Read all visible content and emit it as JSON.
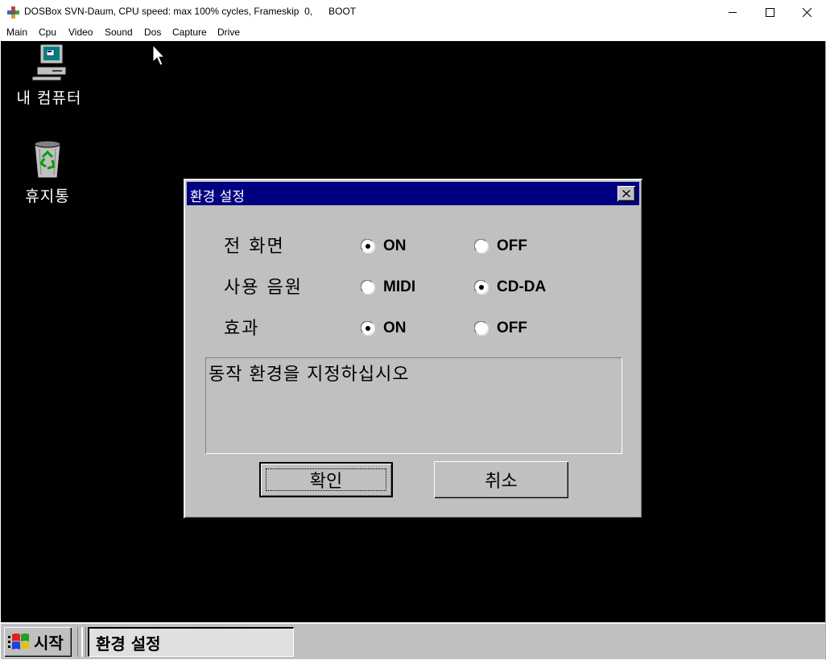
{
  "host_window": {
    "title": "DOSBox SVN-Daum, CPU speed: max 100% cycles, Frameskip  0,      BOOT",
    "menu": [
      "Main",
      "Cpu",
      "Video",
      "Sound",
      "Dos",
      "Capture",
      "Drive"
    ],
    "controls": {
      "minimize_icon": "minimize-icon",
      "maximize_icon": "maximize-icon",
      "close_icon": "close-icon"
    }
  },
  "desktop": {
    "icons": [
      {
        "label": "내 컴퓨터",
        "icon": "my-computer-icon"
      },
      {
        "label": "휴지통",
        "icon": "recycle-bin-icon"
      }
    ]
  },
  "dialog": {
    "title": "환경 설정",
    "rows": [
      {
        "label": "전 화면",
        "options": [
          "ON",
          "OFF"
        ],
        "selected": "ON"
      },
      {
        "label": "사용 음원",
        "options": [
          "MIDI",
          "CD-DA"
        ],
        "selected": "CD-DA"
      },
      {
        "label": "효과",
        "options": [
          "ON",
          "OFF"
        ],
        "selected": "ON"
      }
    ],
    "message": "동작 환경을 지정하십시오",
    "ok_label": "확인",
    "cancel_label": "취소"
  },
  "taskbar": {
    "start_label": "시작",
    "tasks": [
      "환경 설정"
    ]
  },
  "colors": {
    "desktop": "#000000",
    "window_face": "#c0c0c0",
    "title_active": "#000080"
  }
}
